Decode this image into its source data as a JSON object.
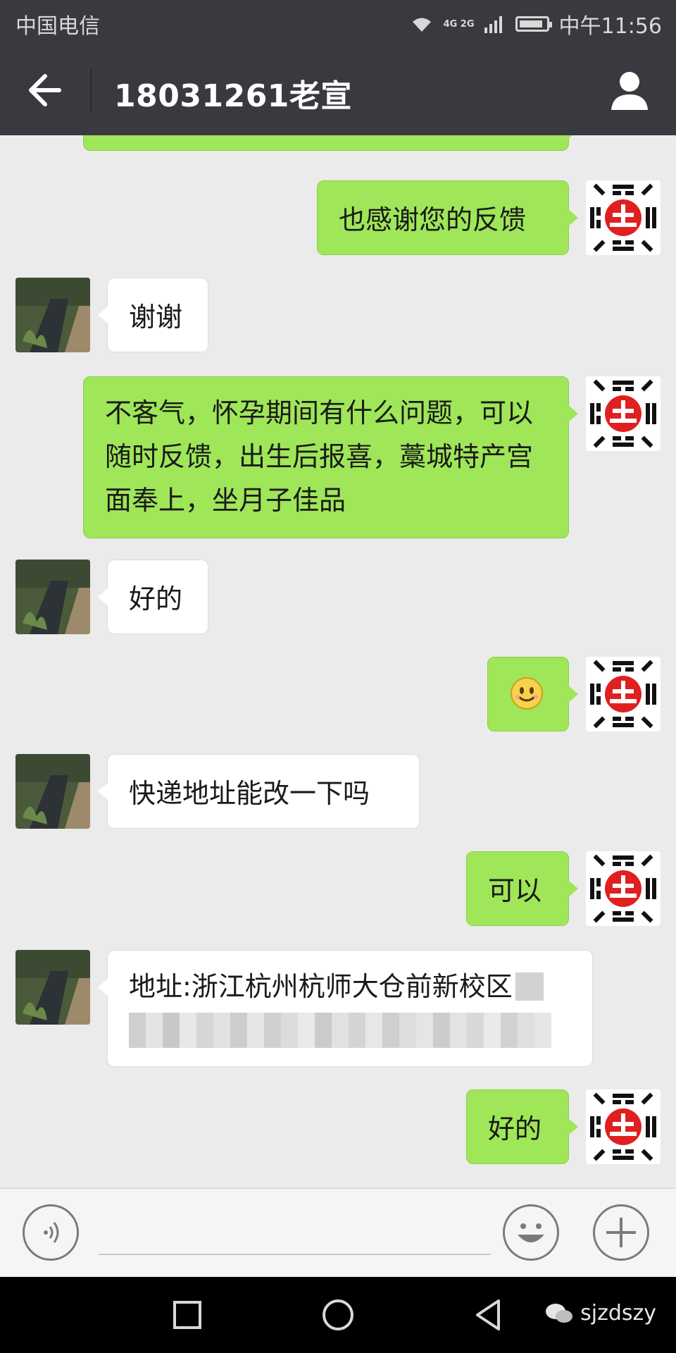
{
  "status_bar": {
    "carrier": "中国电信",
    "network": "4G 2G",
    "time": "中午11:56"
  },
  "header": {
    "title": "18031261老宣"
  },
  "messages": [
    {
      "side": "self",
      "text": ""
    },
    {
      "side": "self",
      "text": "也感谢您的反馈"
    },
    {
      "side": "other",
      "text": "谢谢"
    },
    {
      "side": "self",
      "text": "不客气，怀孕期间有什么问题，可以随时反馈，出生后报喜，藁城特产宫面奉上，坐月子佳品"
    },
    {
      "side": "other",
      "text": "好的"
    },
    {
      "side": "self",
      "emoji": "smile-emoji"
    },
    {
      "side": "other",
      "text": "快递地址能改一下吗"
    },
    {
      "side": "self",
      "text": "可以"
    },
    {
      "side": "other",
      "text": "地址:浙江杭州杭师大仓前新校区"
    },
    {
      "side": "self",
      "text": "好的"
    }
  ],
  "input_bar": {
    "placeholder": ""
  },
  "watermark": {
    "text": "sjzdszy"
  },
  "colors": {
    "header_bg": "#393a3f",
    "self_bubble": "#9fe658",
    "other_bubble": "#ffffff",
    "chat_bg": "#ebebeb"
  }
}
